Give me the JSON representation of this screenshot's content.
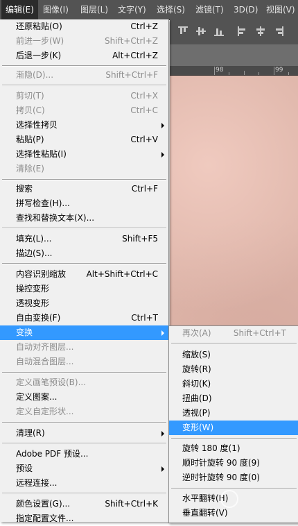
{
  "menubar": {
    "items": [
      {
        "label": "编辑(E)",
        "active": true
      },
      {
        "label": "图像(I)",
        "active": false
      },
      {
        "label": "图层(L)",
        "active": false
      },
      {
        "label": "文字(Y)",
        "active": false
      },
      {
        "label": "选择(S)",
        "active": false
      },
      {
        "label": "滤镜(T)",
        "active": false
      },
      {
        "label": "3D(D)",
        "active": false
      },
      {
        "label": "视图(V)",
        "active": false
      }
    ]
  },
  "ruler": {
    "labels": [
      "98",
      "99"
    ]
  },
  "edit_menu": {
    "items": [
      {
        "label": "还原粘贴(O)",
        "shortcut": "Ctrl+Z",
        "disabled": false,
        "submenu": false
      },
      {
        "label": "前进一步(W)",
        "shortcut": "Shift+Ctrl+Z",
        "disabled": true,
        "submenu": false
      },
      {
        "label": "后退一步(K)",
        "shortcut": "Alt+Ctrl+Z",
        "disabled": false,
        "submenu": false
      },
      {
        "label": "渐隐(D)...",
        "shortcut": "Shift+Ctrl+F",
        "disabled": true,
        "submenu": false
      },
      {
        "label": "剪切(T)",
        "shortcut": "Ctrl+X",
        "disabled": true,
        "submenu": false
      },
      {
        "label": "拷贝(C)",
        "shortcut": "Ctrl+C",
        "disabled": true,
        "submenu": false
      },
      {
        "label": "选择性拷贝",
        "shortcut": "",
        "disabled": false,
        "submenu": true
      },
      {
        "label": "粘贴(P)",
        "shortcut": "Ctrl+V",
        "disabled": false,
        "submenu": false
      },
      {
        "label": "选择性粘贴(I)",
        "shortcut": "",
        "disabled": false,
        "submenu": true
      },
      {
        "label": "清除(E)",
        "shortcut": "",
        "disabled": true,
        "submenu": false
      },
      {
        "label": "搜索",
        "shortcut": "Ctrl+F",
        "disabled": false,
        "submenu": false
      },
      {
        "label": "拼写检查(H)...",
        "shortcut": "",
        "disabled": false,
        "submenu": false
      },
      {
        "label": "查找和替换文本(X)...",
        "shortcut": "",
        "disabled": false,
        "submenu": false
      },
      {
        "label": "填充(L)...",
        "shortcut": "Shift+F5",
        "disabled": false,
        "submenu": false
      },
      {
        "label": "描边(S)...",
        "shortcut": "",
        "disabled": false,
        "submenu": false
      },
      {
        "label": "内容识别缩放",
        "shortcut": "Alt+Shift+Ctrl+C",
        "disabled": false,
        "submenu": false
      },
      {
        "label": "操控变形",
        "shortcut": "",
        "disabled": false,
        "submenu": false
      },
      {
        "label": "透视变形",
        "shortcut": "",
        "disabled": false,
        "submenu": false
      },
      {
        "label": "自由变换(F)",
        "shortcut": "Ctrl+T",
        "disabled": false,
        "submenu": false
      },
      {
        "label": "变换",
        "shortcut": "",
        "disabled": false,
        "submenu": true,
        "highlight": true
      },
      {
        "label": "自动对齐图层...",
        "shortcut": "",
        "disabled": true,
        "submenu": false
      },
      {
        "label": "自动混合图层...",
        "shortcut": "",
        "disabled": true,
        "submenu": false
      },
      {
        "label": "定义画笔预设(B)...",
        "shortcut": "",
        "disabled": true,
        "submenu": false
      },
      {
        "label": "定义图案...",
        "shortcut": "",
        "disabled": false,
        "submenu": false
      },
      {
        "label": "定义自定形状...",
        "shortcut": "",
        "disabled": true,
        "submenu": false
      },
      {
        "label": "清理(R)",
        "shortcut": "",
        "disabled": false,
        "submenu": true
      },
      {
        "label": "Adobe PDF 预设...",
        "shortcut": "",
        "disabled": false,
        "submenu": false
      },
      {
        "label": "预设",
        "shortcut": "",
        "disabled": false,
        "submenu": true
      },
      {
        "label": "远程连接...",
        "shortcut": "",
        "disabled": false,
        "submenu": false
      },
      {
        "label": "颜色设置(G)...",
        "shortcut": "Shift+Ctrl+K",
        "disabled": false,
        "submenu": false
      },
      {
        "label": "指定配置文件...",
        "shortcut": "",
        "disabled": false,
        "submenu": false
      }
    ]
  },
  "transform_submenu": {
    "items": [
      {
        "label": "再次(A)",
        "shortcut": "Shift+Ctrl+T",
        "disabled": true
      },
      {
        "label": "缩放(S)",
        "shortcut": "",
        "disabled": false
      },
      {
        "label": "旋转(R)",
        "shortcut": "",
        "disabled": false
      },
      {
        "label": "斜切(K)",
        "shortcut": "",
        "disabled": false
      },
      {
        "label": "扭曲(D)",
        "shortcut": "",
        "disabled": false
      },
      {
        "label": "透视(P)",
        "shortcut": "",
        "disabled": false
      },
      {
        "label": "变形(W)",
        "shortcut": "",
        "disabled": false,
        "highlight": true
      },
      {
        "label": "旋转 180 度(1)",
        "shortcut": "",
        "disabled": false
      },
      {
        "label": "顺时针旋转 90 度(9)",
        "shortcut": "",
        "disabled": false
      },
      {
        "label": "逆时针旋转 90 度(0)",
        "shortcut": "",
        "disabled": false
      },
      {
        "label": "水平翻转(H)",
        "shortcut": "",
        "disabled": false
      },
      {
        "label": "垂直翻转(V)",
        "shortcut": "",
        "disabled": false
      }
    ]
  },
  "icons": [
    "align-top-icon",
    "align-vcenter-icon",
    "align-bottom-icon",
    "align-left-icon",
    "align-hcenter-icon",
    "align-right-icon"
  ],
  "colors": {
    "highlight": "#3399ff",
    "menubar": "#535353",
    "menu_bg": "#f0f0f0",
    "canvas": "#ddb4a8"
  }
}
